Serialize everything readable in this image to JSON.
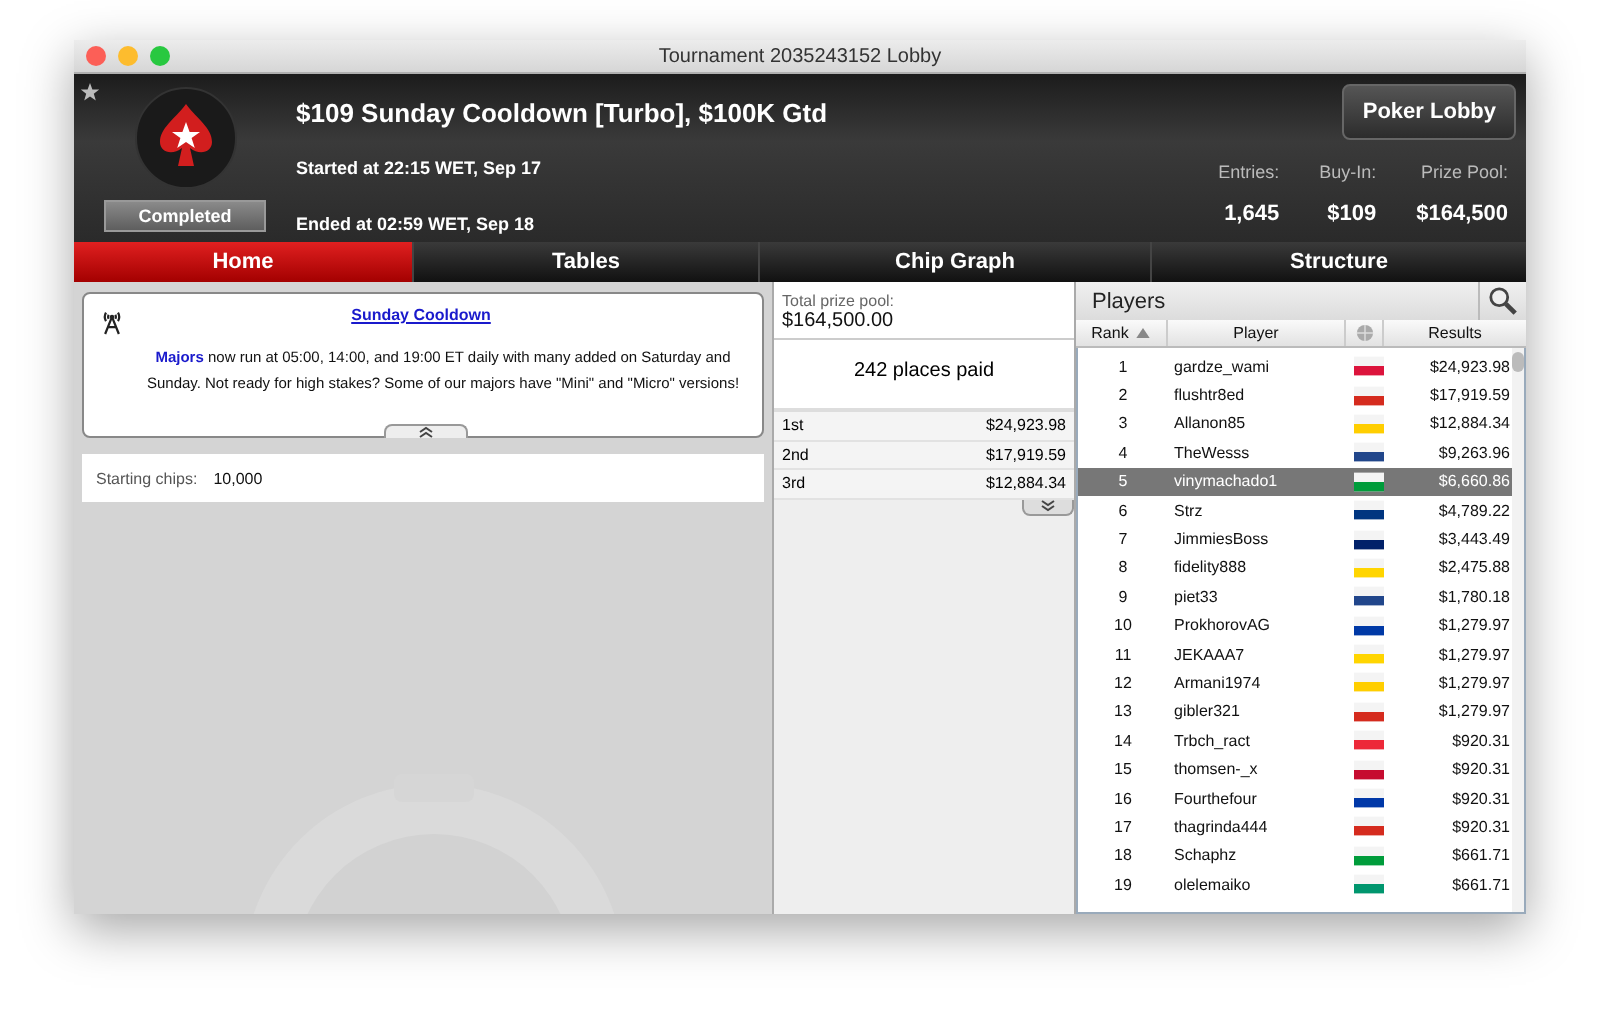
{
  "window": {
    "title": "Tournament 2035243152 Lobby"
  },
  "header": {
    "title": "$109 Sunday Cooldown [Turbo], $100K Gtd",
    "started": "Started at 22:15 WET, Sep 17",
    "ended": "Ended at 02:59 WET, Sep 18",
    "status": "Completed",
    "button": "Poker Lobby",
    "stats": [
      {
        "label": "Entries:",
        "value": "1,645"
      },
      {
        "label": "Buy-In:",
        "value": "$109"
      },
      {
        "label": "Prize Pool:",
        "value": "$164,500"
      }
    ]
  },
  "tabs": [
    {
      "label": "Home",
      "selected": true
    },
    {
      "label": "Tables",
      "selected": false
    },
    {
      "label": "Chip Graph",
      "selected": false
    },
    {
      "label": "Structure",
      "selected": false
    }
  ],
  "news": {
    "heading": "Sunday Cooldown",
    "link": "Majors",
    "text": "now run at 05:00, 14:00, and 19:00 ET daily with many added on Saturday and Sunday. Not ready for high stakes? Some of our majors have \"Mini\" and \"Micro\" versions!"
  },
  "starting_chips": {
    "label": "Starting chips:",
    "value": "10,000"
  },
  "prize_pool": {
    "label": "Total prize pool:",
    "value": "$164,500.00",
    "places_paid": "242 places paid",
    "places": [
      {
        "place": "1st",
        "amount": "$24,923.98"
      },
      {
        "place": "2nd",
        "amount": "$17,919.59"
      },
      {
        "place": "3rd",
        "amount": "$12,884.34"
      }
    ]
  },
  "players": {
    "title": "Players",
    "columns": [
      "Rank",
      "Player",
      "Results"
    ],
    "rows": [
      {
        "rank": "1",
        "name": "gardze_wami",
        "color": "#dc143c",
        "result": "$24,923.98",
        "selected": false
      },
      {
        "rank": "2",
        "name": "flushtr8ed",
        "color": "#d52b1e",
        "result": "$17,919.59",
        "selected": false
      },
      {
        "rank": "3",
        "name": "Allanon85",
        "color": "#ffce00",
        "result": "$12,884.34",
        "selected": false
      },
      {
        "rank": "4",
        "name": "TheWesss",
        "color": "#21468b",
        "result": "$9,263.96",
        "selected": false
      },
      {
        "rank": "5",
        "name": "vinymachado1",
        "color": "#009c3b",
        "result": "$6,660.86",
        "selected": true
      },
      {
        "rank": "6",
        "name": "Strz",
        "color": "#003580",
        "result": "$4,789.22",
        "selected": false
      },
      {
        "rank": "7",
        "name": "JimmiesBoss",
        "color": "#012169",
        "result": "$3,443.49",
        "selected": false
      },
      {
        "rank": "8",
        "name": "fidelity888",
        "color": "#ffd500",
        "result": "$2,475.88",
        "selected": false
      },
      {
        "rank": "9",
        "name": "piet33",
        "color": "#21468b",
        "result": "$1,780.18",
        "selected": false
      },
      {
        "rank": "10",
        "name": "ProkhorovAG",
        "color": "#0039a6",
        "result": "$1,279.97",
        "selected": false
      },
      {
        "rank": "11",
        "name": "JEKAAA7",
        "color": "#ffd500",
        "result": "$1,279.97",
        "selected": false
      },
      {
        "rank": "12",
        "name": "Armani1974",
        "color": "#ffce00",
        "result": "$1,279.97",
        "selected": false
      },
      {
        "rank": "13",
        "name": "gibler321",
        "color": "#d52b1e",
        "result": "$1,279.97",
        "selected": false
      },
      {
        "rank": "14",
        "name": "Trbch_ract",
        "color": "#ed2939",
        "result": "$920.31",
        "selected": false
      },
      {
        "rank": "15",
        "name": "thomsen-_x",
        "color": "#c60c30",
        "result": "$920.31",
        "selected": false
      },
      {
        "rank": "16",
        "name": "Fourthefour",
        "color": "#0038a8",
        "result": "$920.31",
        "selected": false
      },
      {
        "rank": "17",
        "name": "thagrinda444",
        "color": "#d52b1e",
        "result": "$920.31",
        "selected": false
      },
      {
        "rank": "18",
        "name": "Schaphz",
        "color": "#009c3b",
        "result": "$661.71",
        "selected": false
      },
      {
        "rank": "19",
        "name": "olelemaiko",
        "color": "#00966e",
        "result": "$661.71",
        "selected": false
      }
    ]
  }
}
